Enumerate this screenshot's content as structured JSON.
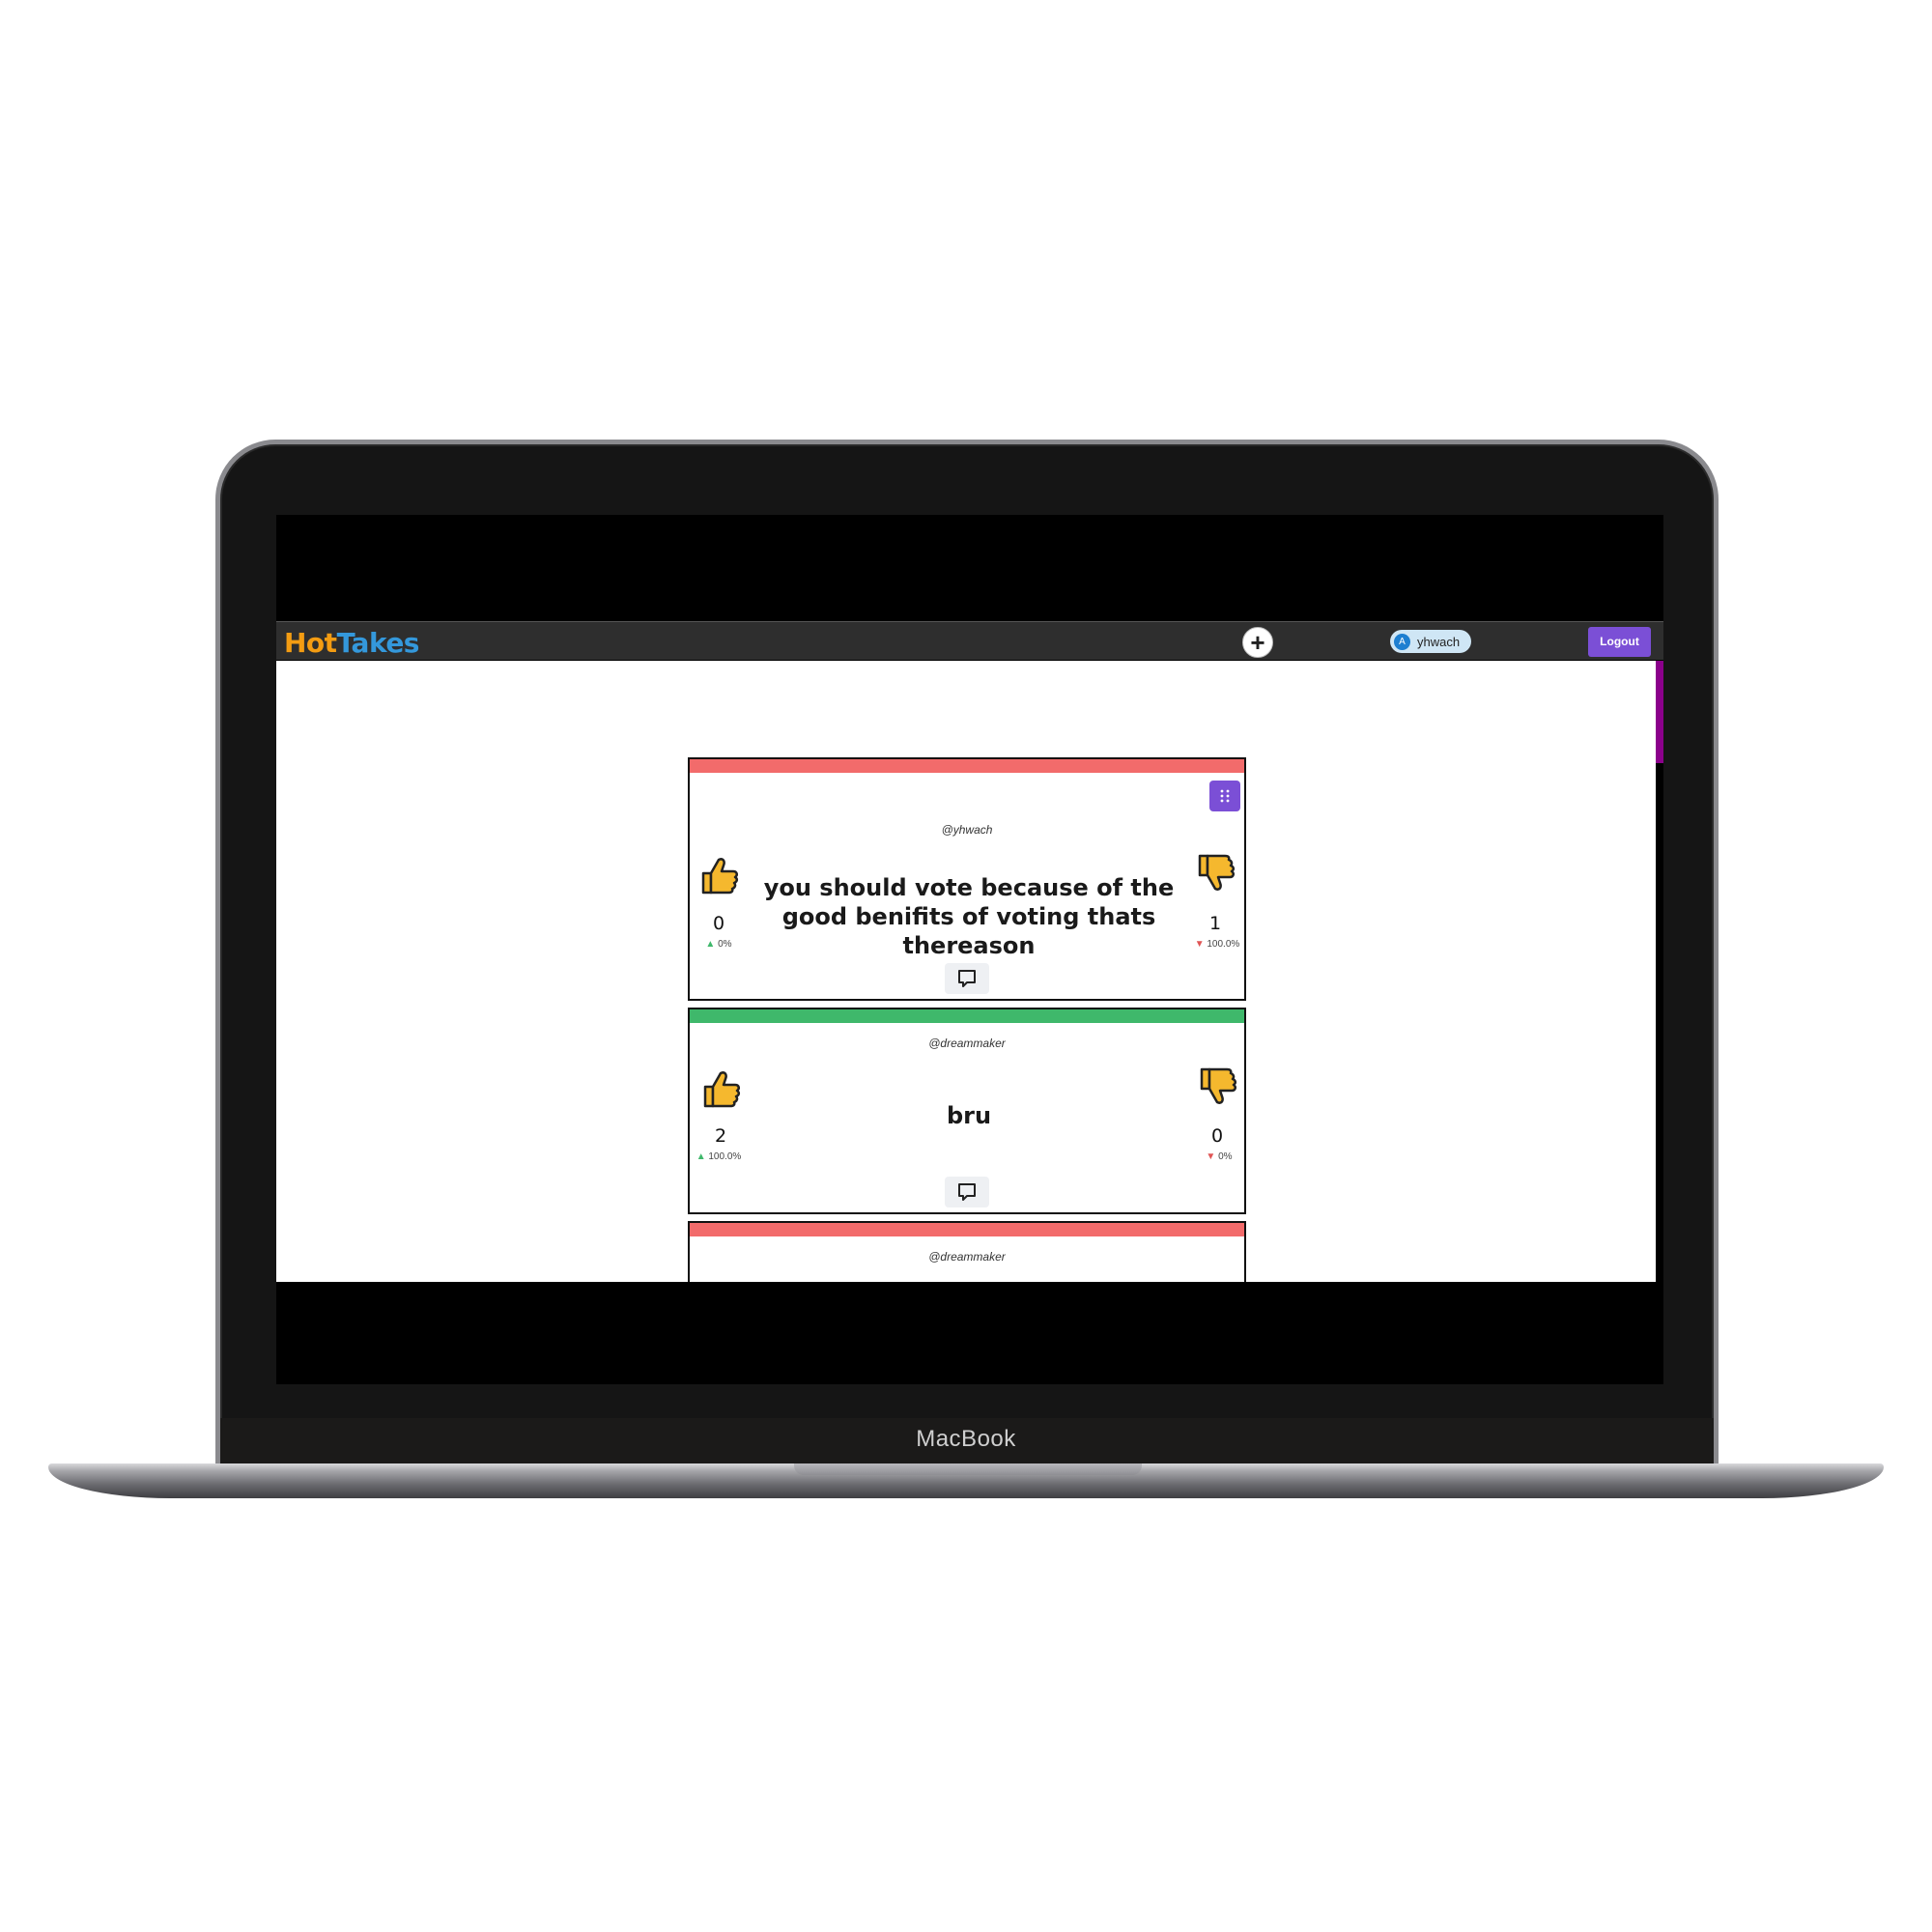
{
  "device": {
    "brand_label": "MacBook"
  },
  "app": {
    "logo_hot": "Hot",
    "logo_takes": "Takes",
    "add_symbol": "+",
    "user_avatar_letter": "A",
    "username": "yhwach",
    "logout_label": "Logout"
  },
  "colors": {
    "accent": "#7b4fd6",
    "hot": "#f39c12",
    "takes": "#3498db",
    "positive": "#3fb86b",
    "negative": "#f26b6b"
  },
  "takes": [
    {
      "author": "@yhwach",
      "text": "you should vote because of the good benifits of voting thats thereason",
      "likes": "0",
      "like_pct": "0%",
      "dislikes": "1",
      "dislike_pct": "100.0%",
      "status": "negative",
      "has_menu": true
    },
    {
      "author": "@dreammaker",
      "text": "bru",
      "likes": "2",
      "like_pct": "100.0%",
      "dislikes": "0",
      "dislike_pct": "0%",
      "status": "positive",
      "has_menu": false
    },
    {
      "author": "@dreammaker",
      "status": "negative"
    }
  ],
  "icons": {
    "thumbs_up": "thumbs-up-icon",
    "thumbs_down": "thumbs-down-icon",
    "comment": "comment-icon",
    "menu": "grid-dots-icon"
  }
}
